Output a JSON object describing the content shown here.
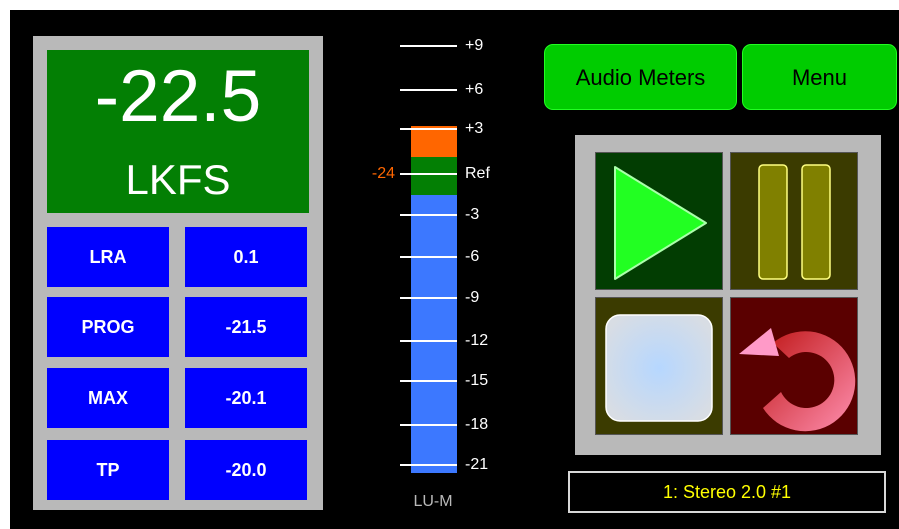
{
  "loudness": {
    "value": "-22.5",
    "unit": "LKFS"
  },
  "stats": [
    {
      "label": "LRA",
      "value": "0.1"
    },
    {
      "label": "PROG",
      "value": "-21.5"
    },
    {
      "label": "MAX",
      "value": "-20.1"
    },
    {
      "label": "TP",
      "value": "-20.0"
    }
  ],
  "meter": {
    "scale": [
      "+9",
      "+6",
      "+3",
      "Ref",
      "-3",
      "-6",
      "-9",
      "-12",
      "-15",
      "-18",
      "-21"
    ],
    "ref_value": "-24",
    "unit": "LU-M"
  },
  "buttons": {
    "audio_meters": "Audio Meters",
    "menu": "Menu"
  },
  "transport": [
    "play",
    "pause",
    "stop",
    "reset"
  ],
  "input_label": "1: Stereo 2.0 #1",
  "colors": {
    "loudness_box": "#037f04",
    "stat_box": "#0000ff",
    "meter_blue": "#3c78ff",
    "meter_green": "#037f04",
    "meter_orange": "#ff6600",
    "button_green": "#00cc00",
    "label_yellow": "#ffff00"
  }
}
